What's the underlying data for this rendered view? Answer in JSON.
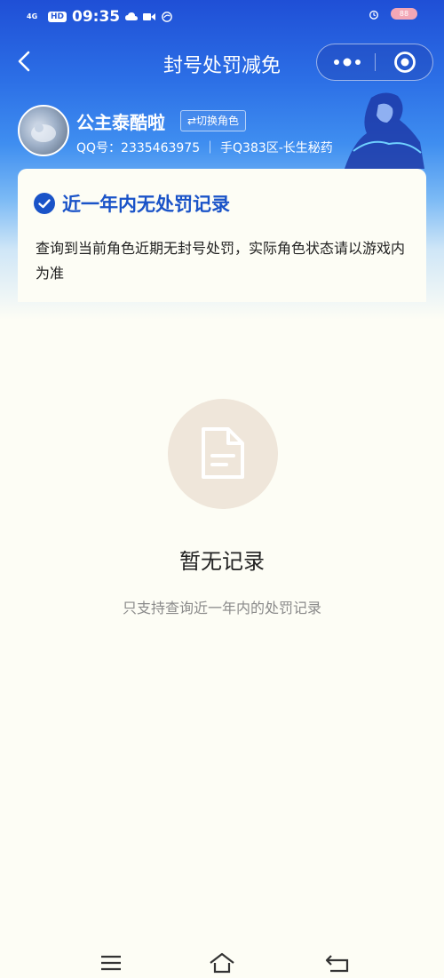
{
  "status_bar": {
    "network_label": "4G",
    "hd_label": "HD",
    "time": "09:35",
    "battery": "88"
  },
  "nav": {
    "title": "封号处罚减免"
  },
  "profile": {
    "name": "公主泰酷啦",
    "switch_label": "⇄切换角色",
    "info": "QQ号：2335463975 ｜ 手Q383区-长生秘药"
  },
  "card": {
    "title": "近一年内无处罚记录",
    "description": "查询到当前角色近期无封号处罚，实际角色状态请以游戏内为准"
  },
  "empty_state": {
    "title": "暂无记录",
    "subtitle": "只支持查询近一年内的处罚记录"
  },
  "colors": {
    "accent_blue": "#1a53c8",
    "header_blue": "#1f4fd6",
    "page_bg": "#fdfdf5",
    "empty_circle": "#efe6da"
  },
  "icons": [
    "back-icon",
    "more-icon",
    "target-icon",
    "check-circle-icon",
    "document-icon",
    "menu-icon",
    "home-icon",
    "return-icon"
  ]
}
